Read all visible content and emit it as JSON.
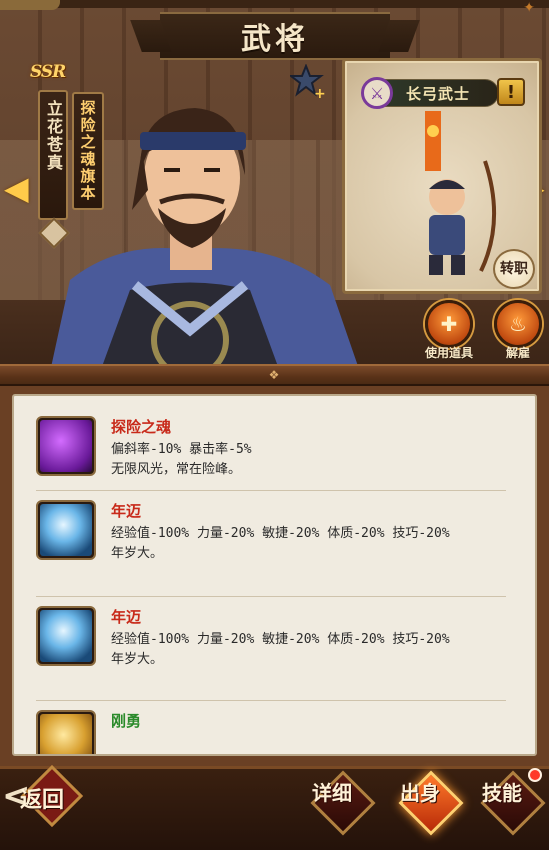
{
  "header": {
    "title": "武将"
  },
  "hero": {
    "rarity": "SSR",
    "name": "立花苍真",
    "title": "探险之魂旗本"
  },
  "class_card": {
    "class_name": "长弓武士",
    "alert": "!",
    "transfer_label": "转职"
  },
  "actions": {
    "use_item": "使用道具",
    "dismiss": "解雇"
  },
  "skills": [
    {
      "name": "探险之魂",
      "name_color": "#c82a1a",
      "icon": "purple-soul-icon",
      "stats": "偏斜率-10%   暴击率-5%",
      "description": "无限风光，常在险峰。"
    },
    {
      "name": "年迈",
      "name_color": "#c82a1a",
      "icon": "blue-ghost-icon",
      "stats": "经验值-100%   力量-20%   敏捷-20%   体质-20%   技巧-20%",
      "description": "年岁大。"
    },
    {
      "name": "年迈",
      "name_color": "#c82a1a",
      "icon": "blue-ghost-icon",
      "stats": "经验值-100%   力量-20%   敏捷-20%   体质-20%   技巧-20%",
      "description": "年岁大。"
    },
    {
      "name": "刚勇",
      "name_color": "#2a8a2a",
      "icon": "gold-upgrade-icon"
    }
  ],
  "bottom_nav": {
    "back": "返回",
    "details": "详细",
    "origin": "出身",
    "skills": "技能"
  }
}
